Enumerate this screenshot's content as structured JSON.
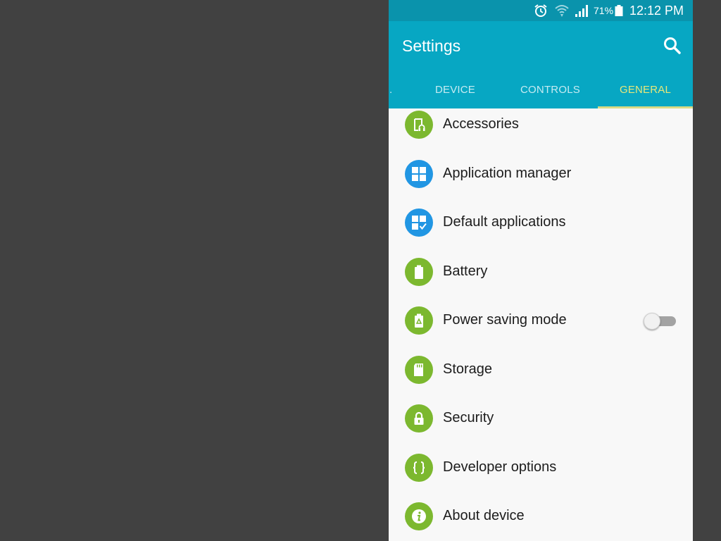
{
  "status_bar": {
    "icons": [
      "alarm-icon",
      "wifi-icon",
      "signal-icon",
      "battery-icon"
    ],
    "battery_percent": "71%",
    "time": "12:12 PM"
  },
  "app_bar": {
    "title": "Settings",
    "search_icon": "search-icon"
  },
  "tabs": [
    {
      "label": "..",
      "active": false
    },
    {
      "label": "DEVICE",
      "active": false
    },
    {
      "label": "CONTROLS",
      "active": false
    },
    {
      "label": "GENERAL",
      "active": true
    }
  ],
  "items": [
    {
      "label": "Accessories",
      "icon": "accessories-icon",
      "color": "#7cb82f"
    },
    {
      "label": "Application manager",
      "icon": "grid-icon",
      "color": "#2196e3"
    },
    {
      "label": "Default applications",
      "icon": "grid-check-icon",
      "color": "#2196e3"
    },
    {
      "label": "Battery",
      "icon": "battery-icon",
      "color": "#7cb82f"
    },
    {
      "label": "Power saving mode",
      "icon": "power-saving-icon",
      "color": "#7cb82f",
      "toggle": false
    },
    {
      "label": "Storage",
      "icon": "sd-card-icon",
      "color": "#7cb82f"
    },
    {
      "label": "Security",
      "icon": "lock-icon",
      "color": "#7cb82f"
    },
    {
      "label": "Developer options",
      "icon": "braces-icon",
      "color": "#7cb82f"
    },
    {
      "label": "About device",
      "icon": "info-icon",
      "color": "#7cb82f"
    }
  ],
  "colors": {
    "status_bar": "#0a93ac",
    "app_bar": "#07a7c3",
    "active_tab": "#e7e77a",
    "inactive_tab": "#c6ebf2",
    "green_icon": "#7cb82f",
    "blue_icon": "#2196e3",
    "list_background": "#f8f8f8",
    "outer_background": "#414141"
  }
}
